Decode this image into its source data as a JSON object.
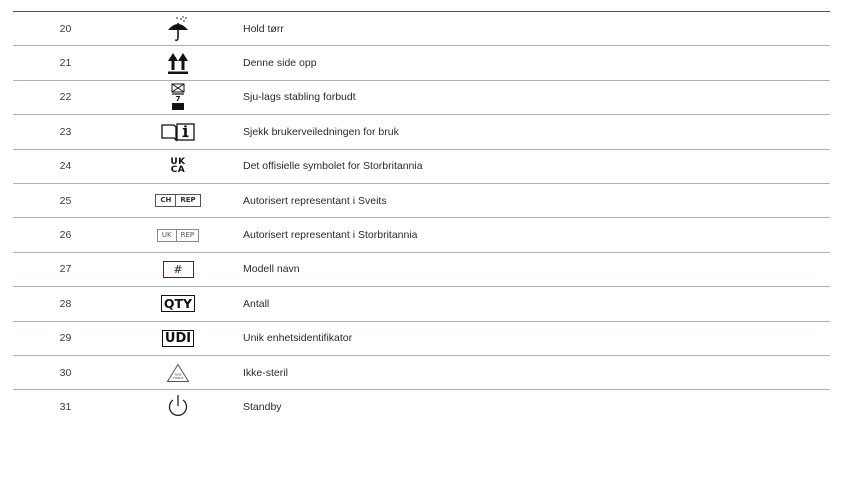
{
  "rows": [
    {
      "num": "20",
      "symbol": "umbrella-icon",
      "text": "Hold tørr"
    },
    {
      "num": "21",
      "symbol": "this-way-up-icon",
      "text": "Denne side opp"
    },
    {
      "num": "22",
      "symbol": "stacking-limit-icon",
      "text": "Sju-lags stabling forbudt",
      "stack_limit": "7"
    },
    {
      "num": "23",
      "symbol": "instructions-for-use-icon",
      "text": "Sjekk brukerveiledningen for bruk"
    },
    {
      "num": "24",
      "symbol": "ukca-mark",
      "text": "Det offisielle symbolet for Storbritannia",
      "mark_top": "UK",
      "mark_bottom": "CA"
    },
    {
      "num": "25",
      "symbol": "ch-rep-label",
      "text": "Autorisert representant i Sveits",
      "label_a": "CH",
      "label_b": "REP"
    },
    {
      "num": "26",
      "symbol": "uk-rep-label",
      "text": "Autorisert representant i Storbritannia",
      "label_a": "UK",
      "label_b": "REP"
    },
    {
      "num": "27",
      "symbol": "model-number-icon",
      "text": "Modell navn",
      "label": "#"
    },
    {
      "num": "28",
      "symbol": "quantity-label",
      "text": "Antall",
      "label": "QTY"
    },
    {
      "num": "29",
      "symbol": "udi-label",
      "text": "Unik enhetsidentifikator",
      "label": "UDI"
    },
    {
      "num": "30",
      "symbol": "non-sterile-icon",
      "text": "Ikke-steril",
      "label_a": "NON",
      "label_b": "STERILE"
    },
    {
      "num": "31",
      "symbol": "standby-icon",
      "text": "Standby"
    }
  ]
}
